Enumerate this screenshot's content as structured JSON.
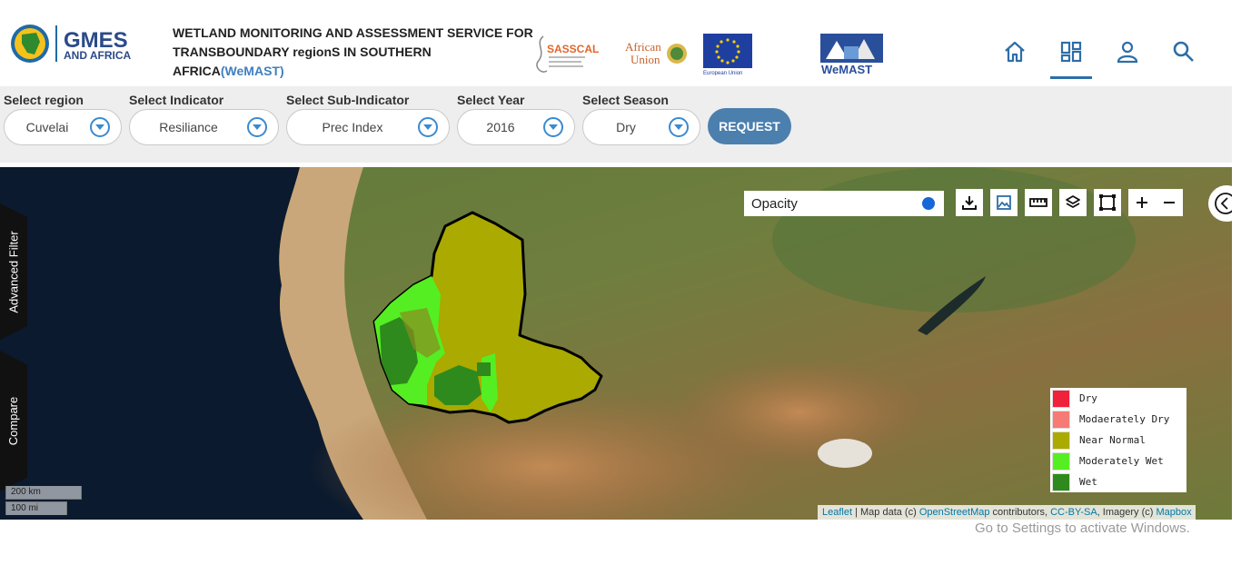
{
  "header": {
    "logo_text_line1": "GMES",
    "logo_text_line2": "AND AFRICA",
    "title_line1": "WETLAND MONITORING AND ASSESSMENT SERVICE FOR",
    "title_line2": "TRANSBOUNDARY regionS IN SOUTHERN AFRICA",
    "title_accent": "(WeMAST)",
    "partners": {
      "sasscal": "SASSCAL",
      "african_union": "African Union",
      "eu": "European Union",
      "wemast": "WeMAST"
    },
    "nav_icons": [
      "home-icon",
      "dashboard-icon",
      "user-icon",
      "search-icon"
    ],
    "accent_color": "#2d6ea8"
  },
  "filters": {
    "region": {
      "label": "Select region",
      "value": "Cuvelai"
    },
    "indicator": {
      "label": "Select Indicator",
      "value": "Resiliance"
    },
    "sub_indicator": {
      "label": "Select Sub-Indicator",
      "value": "Prec Index"
    },
    "year": {
      "label": "Select Year",
      "value": "2016"
    },
    "season": {
      "label": "Select Season",
      "value": "Dry"
    },
    "request_label": "REQUEST"
  },
  "map": {
    "side_tabs": {
      "advanced_filter": "Advanced Filter",
      "compare": "Compare"
    },
    "opacity_label": "Opacity",
    "tools": [
      "download-icon",
      "image-icon",
      "ruler-icon",
      "layers-icon",
      "draw-rectangle-icon",
      "zoom-in-icon",
      "zoom-out-icon"
    ],
    "legend": [
      {
        "label": "Dry",
        "color": "#f0213a"
      },
      {
        "label": "Modaerately Dry",
        "color": "#f57b74"
      },
      {
        "label": "Near Normal",
        "color": "#aaaa00"
      },
      {
        "label": "Moderately Wet",
        "color": "#55ee22"
      },
      {
        "label": "Wet",
        "color": "#2e8a1c"
      }
    ],
    "scale": {
      "km": "200 km",
      "mi": "100 mi"
    },
    "attribution": {
      "leaflet": "Leaflet",
      "map_data": " | Map data (c) ",
      "osm": "OpenStreetMap",
      "contributors": " contributors, ",
      "license": "CC-BY-SA",
      "imagery": ", Imagery (c) ",
      "mapbox": "Mapbox"
    }
  },
  "watermark": "Go to Settings to activate Windows."
}
